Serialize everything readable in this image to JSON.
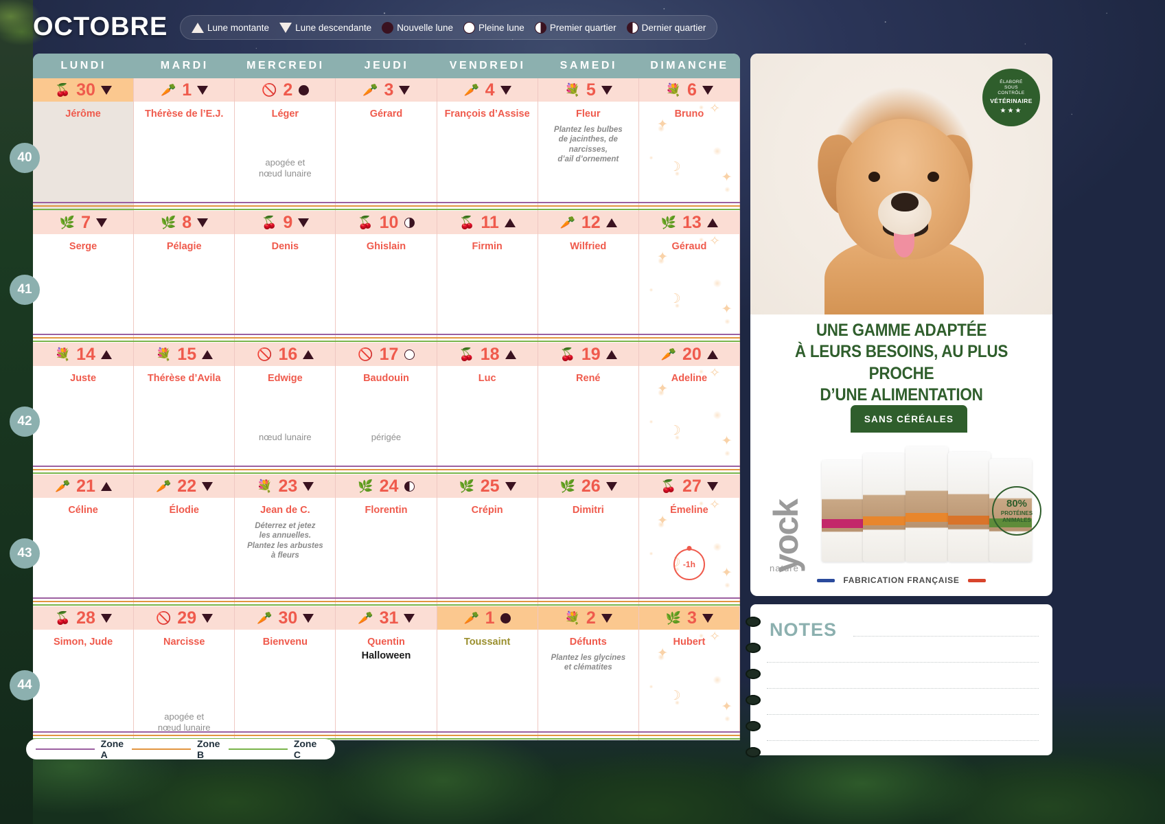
{
  "header": {
    "month": "OCTOBRE",
    "moon_legend": [
      {
        "icon": "triangle-up-icon",
        "label": "Lune montante"
      },
      {
        "icon": "triangle-down-icon",
        "label": "Lune descendante"
      },
      {
        "icon": "new-moon-icon",
        "label": "Nouvelle lune"
      },
      {
        "icon": "full-moon-icon",
        "label": "Pleine lune"
      },
      {
        "icon": "first-quarter-icon",
        "label": "Premier quartier"
      },
      {
        "icon": "last-quarter-icon",
        "label": "Dernier quartier"
      }
    ]
  },
  "calendar": {
    "day_names": [
      "LUNDI",
      "MARDI",
      "MERCREDI",
      "JEUDI",
      "VENDREDI",
      "SAMEDI",
      "DIMANCHE"
    ],
    "week_numbers": [
      "40",
      "41",
      "42",
      "43",
      "44"
    ],
    "cells": [
      {
        "num": "30",
        "saint": "Jérôme",
        "icon": "cherries-icon",
        "phase": "descending",
        "greyed": true,
        "today": true
      },
      {
        "num": "1",
        "saint": "Thérèse de l’E.J.",
        "icon": "carrot-icon",
        "phase": "descending"
      },
      {
        "num": "2",
        "saint": "Léger",
        "icon": "no-garden-icon",
        "phase": "new-moon",
        "lunar": "apogée et\nnœud lunaire"
      },
      {
        "num": "3",
        "saint": "Gérard",
        "icon": "carrot-icon",
        "phase": "descending"
      },
      {
        "num": "4",
        "saint": "François d’Assise",
        "icon": "carrot-icon",
        "phase": "descending"
      },
      {
        "num": "5",
        "saint": "Fleur",
        "icon": "flower-icon",
        "phase": "descending",
        "tip": "Plantez les bulbes\nde jacinthes, de narcisses,\nd’ail d’ornement"
      },
      {
        "num": "6",
        "saint": "Bruno",
        "icon": "flower-icon",
        "phase": "descending",
        "sunday": true
      },
      {
        "num": "7",
        "saint": "Serge",
        "icon": "leaf-icon",
        "phase": "descending"
      },
      {
        "num": "8",
        "saint": "Pélagie",
        "icon": "leaf-icon",
        "phase": "descending"
      },
      {
        "num": "9",
        "saint": "Denis",
        "icon": "cherries-icon",
        "phase": "descending"
      },
      {
        "num": "10",
        "saint": "Ghislain",
        "icon": "cherries-icon",
        "phase": "first-quarter"
      },
      {
        "num": "11",
        "saint": "Firmin",
        "icon": "cherries-icon",
        "phase": "ascending"
      },
      {
        "num": "12",
        "saint": "Wilfried",
        "icon": "carrot-icon",
        "phase": "ascending"
      },
      {
        "num": "13",
        "saint": "Géraud",
        "icon": "leaf-icon",
        "phase": "ascending",
        "sunday": true
      },
      {
        "num": "14",
        "saint": "Juste",
        "icon": "flower-icon",
        "phase": "ascending"
      },
      {
        "num": "15",
        "saint": "Thérèse d’Avila",
        "icon": "flower-icon",
        "phase": "ascending"
      },
      {
        "num": "16",
        "saint": "Edwige",
        "icon": "no-garden-icon",
        "phase": "ascending",
        "lunar": "nœud lunaire"
      },
      {
        "num": "17",
        "saint": "Baudouin",
        "icon": "no-garden-icon",
        "phase": "full-moon",
        "lunar": "périgée"
      },
      {
        "num": "18",
        "saint": "Luc",
        "icon": "cherries-icon",
        "phase": "ascending"
      },
      {
        "num": "19",
        "saint": "René",
        "icon": "cherries-icon",
        "phase": "ascending"
      },
      {
        "num": "20",
        "saint": "Adeline",
        "icon": "carrot-icon",
        "phase": "ascending",
        "sunday": true
      },
      {
        "num": "21",
        "saint": "Céline",
        "icon": "carrot-icon",
        "phase": "ascending"
      },
      {
        "num": "22",
        "saint": "Élodie",
        "icon": "carrot-icon",
        "phase": "descending"
      },
      {
        "num": "23",
        "saint": "Jean de C.",
        "icon": "flower-icon",
        "phase": "descending",
        "tip": "Déterrez et jetez\nles annuelles.\nPlantez les arbustes\nà fleurs"
      },
      {
        "num": "24",
        "saint": "Florentin",
        "icon": "leaf-icon",
        "phase": "last-quarter"
      },
      {
        "num": "25",
        "saint": "Crépin",
        "icon": "leaf-icon",
        "phase": "descending"
      },
      {
        "num": "26",
        "saint": "Dimitri",
        "icon": "leaf-icon",
        "phase": "descending"
      },
      {
        "num": "27",
        "saint": "Émeline",
        "icon": "cherries-icon",
        "phase": "descending",
        "sunday": true,
        "clock": "-1h"
      },
      {
        "num": "28",
        "saint": "Simon, Jude",
        "icon": "cherries-icon",
        "phase": "descending"
      },
      {
        "num": "29",
        "saint": "Narcisse",
        "icon": "no-garden-icon",
        "phase": "descending",
        "lunar": "apogée et\nnœud lunaire"
      },
      {
        "num": "30",
        "saint": "Bienvenu",
        "icon": "carrot-icon",
        "phase": "descending"
      },
      {
        "num": "31",
        "saint": "Quentin",
        "icon": "carrot-icon",
        "phase": "descending",
        "extra": "Halloween"
      },
      {
        "num": "1",
        "saint": "Toussaint",
        "icon": "carrot-icon",
        "phase": "new-moon",
        "holiday": true
      },
      {
        "num": "2",
        "saint": "Défunts",
        "icon": "flower-icon",
        "phase": "descending",
        "holiday": true,
        "tip": "Plantez les glycines\net clématites"
      },
      {
        "num": "3",
        "saint": "Hubert",
        "icon": "leaf-icon",
        "phase": "descending",
        "sunday": true,
        "holiday": true
      }
    ],
    "zone_legend": [
      {
        "name": "Zone A",
        "color": "#9b5fa0"
      },
      {
        "name": "Zone B",
        "color": "#e2953f"
      },
      {
        "name": "Zone C",
        "color": "#79b44a"
      }
    ]
  },
  "ad": {
    "badge_line1": "ÉLABORÉ",
    "badge_line2": "SOUS",
    "badge_line3": "CONTRÔLE",
    "badge_line4": "VÉTÉRINAIRE",
    "badge_stars": "★★★",
    "claim_line1": "UNE GAMME ADAPTÉE",
    "claim_line2": "À LEURS BESOINS, AU PLUS PROCHE",
    "claim_line3": "D’UNE ALIMENTATION NATURELLE",
    "grain_banner": "SANS CÉRÉALES",
    "brand": "yock",
    "brand_sub": "nature",
    "protein_pct": "80%",
    "protein_label": "PROTÉINES ANIMALES",
    "made_in": "FABRICATION FRANÇAISE"
  },
  "notes": {
    "title": "NOTES"
  }
}
